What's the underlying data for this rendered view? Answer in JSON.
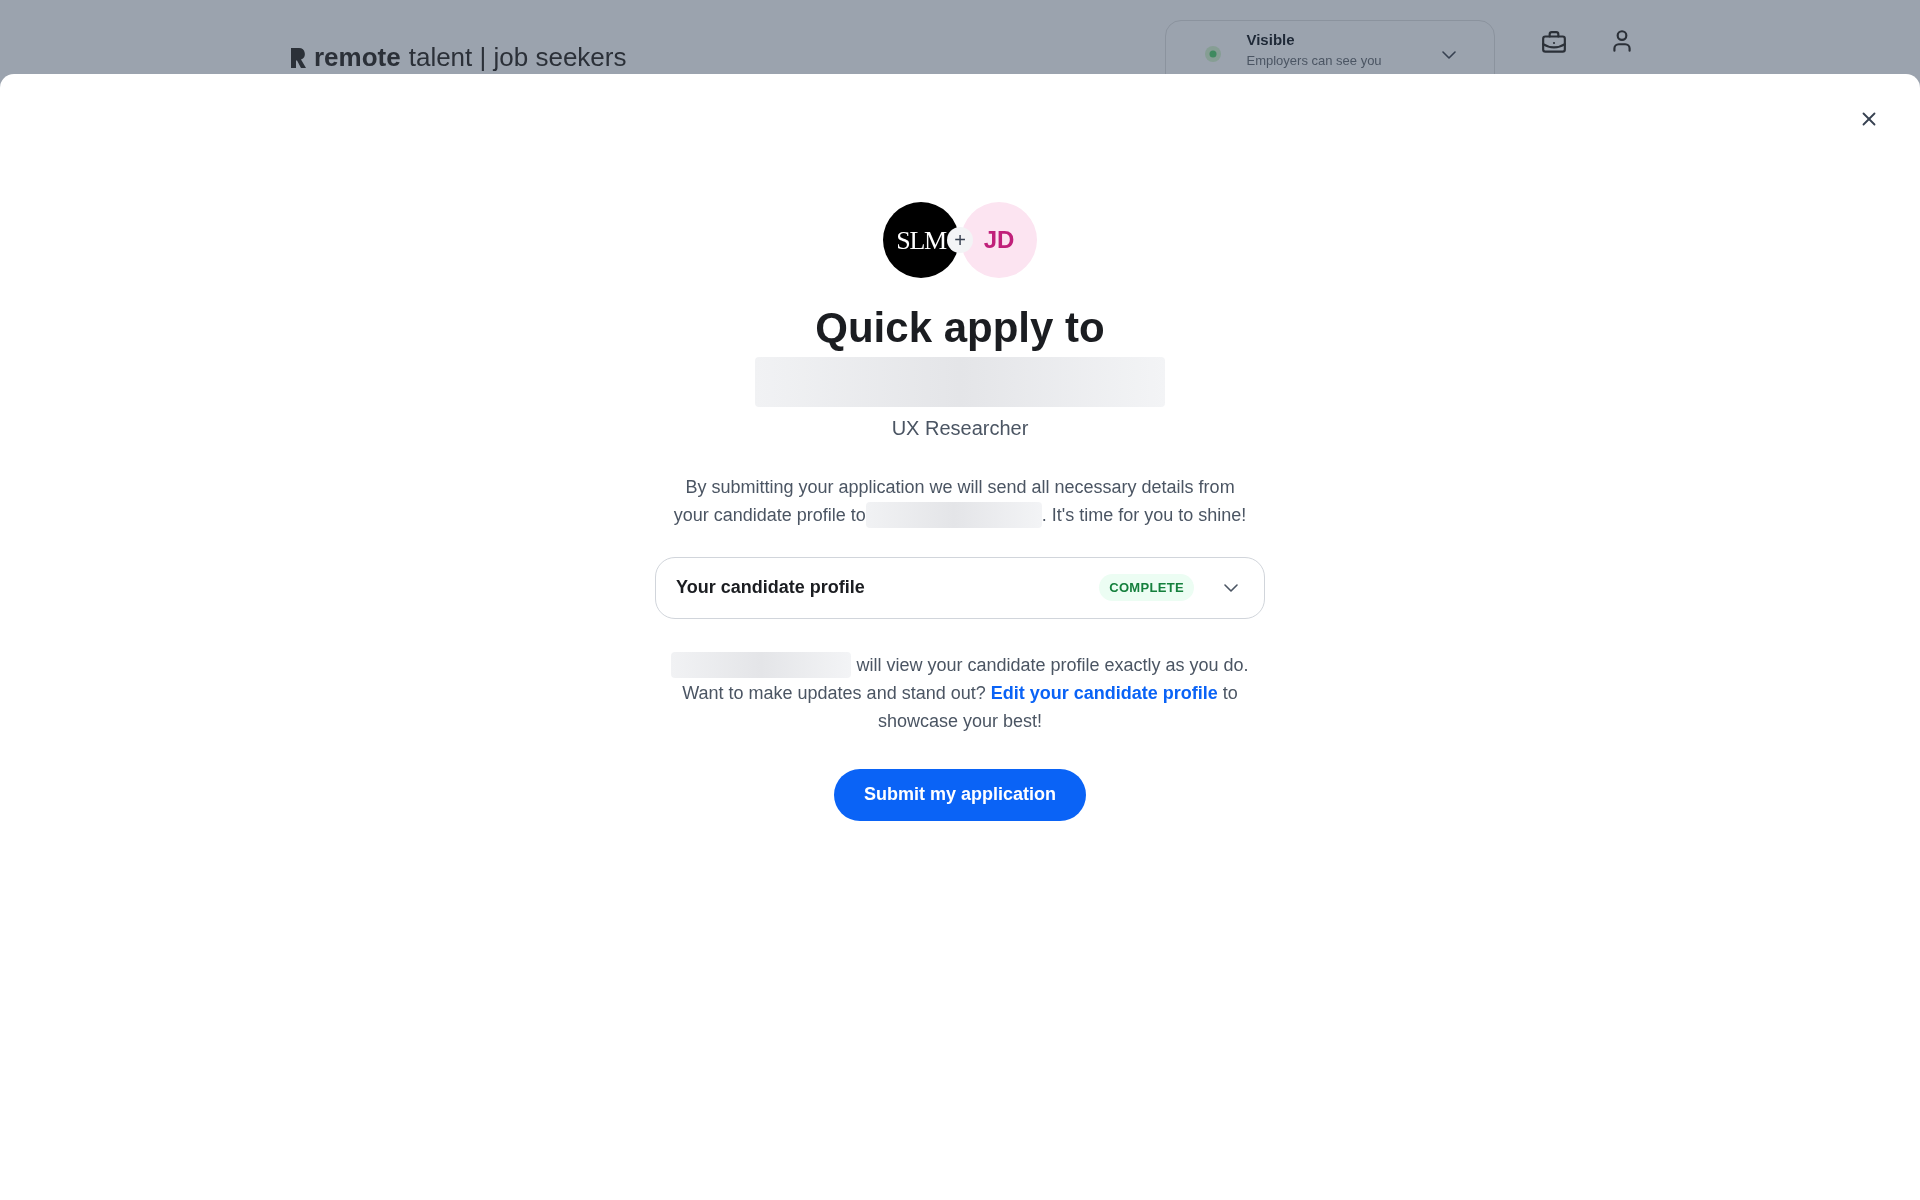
{
  "header": {
    "logo": {
      "bold": "remote",
      "light": "talent | job seekers"
    },
    "visibility": {
      "label": "Visible",
      "hint": "Employers can see you",
      "expanded": false
    }
  },
  "modal": {
    "avatars": [
      {
        "kind": "company",
        "initials": "SLM"
      },
      {
        "kind": "user",
        "initials": "JD"
      }
    ],
    "join": "+",
    "title": "Quick apply to",
    "job_title": "UX Researcher",
    "intro_line": "By submitting your application we will send all necessary details from",
    "intro_before": "your candidate profile to",
    "intro_after": ". It's time for you to shine!",
    "profile_card": {
      "label": "Your candidate profile",
      "status": "COMPLETE",
      "expanded": false
    },
    "note_first": "will view your candidate profile exactly as you do.",
    "note": "Want to make updates and stand out?",
    "edit_link": "Edit your candidate profile",
    "note_after": "to showcase your best!",
    "submit": "Submit my application"
  }
}
